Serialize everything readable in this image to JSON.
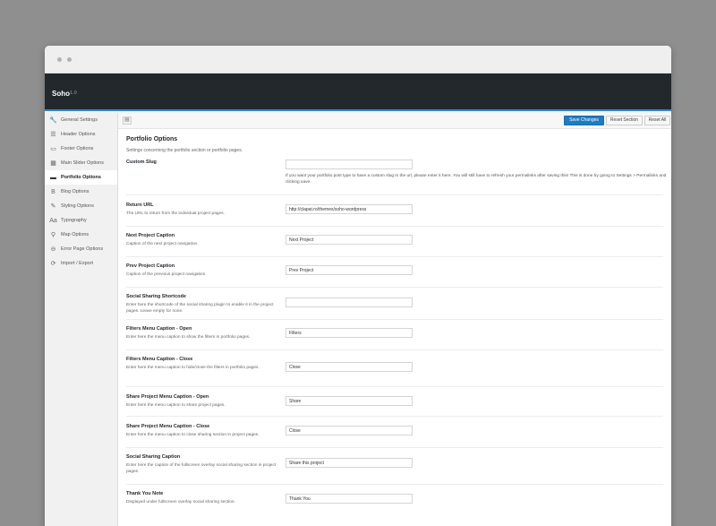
{
  "app": {
    "title": "Soho",
    "version": "1.0"
  },
  "sidebar": {
    "items": [
      {
        "label": "General Settings",
        "icon": "wrench-icon",
        "glyph": "🔧",
        "active": false
      },
      {
        "label": "Header Options",
        "icon": "menu-icon",
        "glyph": "☰",
        "active": false
      },
      {
        "label": "Footer Options",
        "icon": "footer-icon",
        "glyph": "▭",
        "active": false
      },
      {
        "label": "Main Slider Options",
        "icon": "slider-icon",
        "glyph": "▦",
        "active": false
      },
      {
        "label": "Portfolio Options",
        "icon": "folder-icon",
        "glyph": "▬",
        "active": true
      },
      {
        "label": "Blog Options",
        "icon": "blog-icon",
        "glyph": "B",
        "active": false
      },
      {
        "label": "Styling Options",
        "icon": "brush-icon",
        "glyph": "✎",
        "active": false
      },
      {
        "label": "Typography",
        "icon": "typography-icon",
        "glyph": "Aa",
        "active": false
      },
      {
        "label": "Map Options",
        "icon": "map-pin-icon",
        "glyph": "⚲",
        "active": false
      },
      {
        "label": "Error Page Options",
        "icon": "error-icon",
        "glyph": "⊖",
        "active": false
      },
      {
        "label": "Import / Export",
        "icon": "refresh-icon",
        "glyph": "⟳",
        "active": false
      }
    ]
  },
  "toolbar": {
    "save_label": "Save Changes",
    "reset_section_label": "Reset Section",
    "reset_all_label": "Reset All"
  },
  "section": {
    "title": "Portfolio Options",
    "description": "Settings concerning the portfolio section or portfolio pages."
  },
  "fields": {
    "custom_slug": {
      "label": "Custom Slug",
      "value": "",
      "help": "If you want your portfolio post type to have a custom slug in the url, please enter it here. You will still have to refresh your permalinks after saving this! This is done by going to Settings > Permalinks and clicking save."
    },
    "return_url": {
      "label": "Return URL",
      "desc": "The URL to return from the individual project pages.",
      "value": "http://clapat.ro/themes/soho-wordpress"
    },
    "next_caption": {
      "label": "Next Project Caption",
      "desc": "Caption of the next project navigation.",
      "value": "Next Project"
    },
    "prev_caption": {
      "label": "Prev Project Caption",
      "desc": "Caption of the previous project navigation.",
      "value": "Prev Project"
    },
    "social_shortcode": {
      "label": "Social Sharing Shortcode",
      "desc": "Enter here the shortcode of the social sharing plugin to enable it in the project pages. Leave empty for none.",
      "value": ""
    },
    "filters_open": {
      "label": "Filters Menu Caption - Open",
      "desc": "Enter here the menu caption to show the filters in portfolio pages.",
      "value": "Filters"
    },
    "filters_close": {
      "label": "Filters Menu Caption - Close",
      "desc": "Enter here the menu caption to hide/close the filters in portfolio pages.",
      "value": "Close"
    },
    "share_open": {
      "label": "Share Project Menu Caption - Open",
      "desc": "Enter here the menu caption to share project pages.",
      "value": "Share"
    },
    "share_close": {
      "label": "Share Project Menu Caption - Close",
      "desc": "Enter here the menu caption to close sharing section in project pages.",
      "value": "Close"
    },
    "social_caption": {
      "label": "Social Sharing Caption",
      "desc": "Enter here the caption of the fullscreen overlay social sharing section in project pages.",
      "value": "Share this project"
    },
    "thank_you": {
      "label": "Thank You Note",
      "desc": "Displayed under fullscreen overlay social sharing section.",
      "value": "Thank You"
    }
  }
}
